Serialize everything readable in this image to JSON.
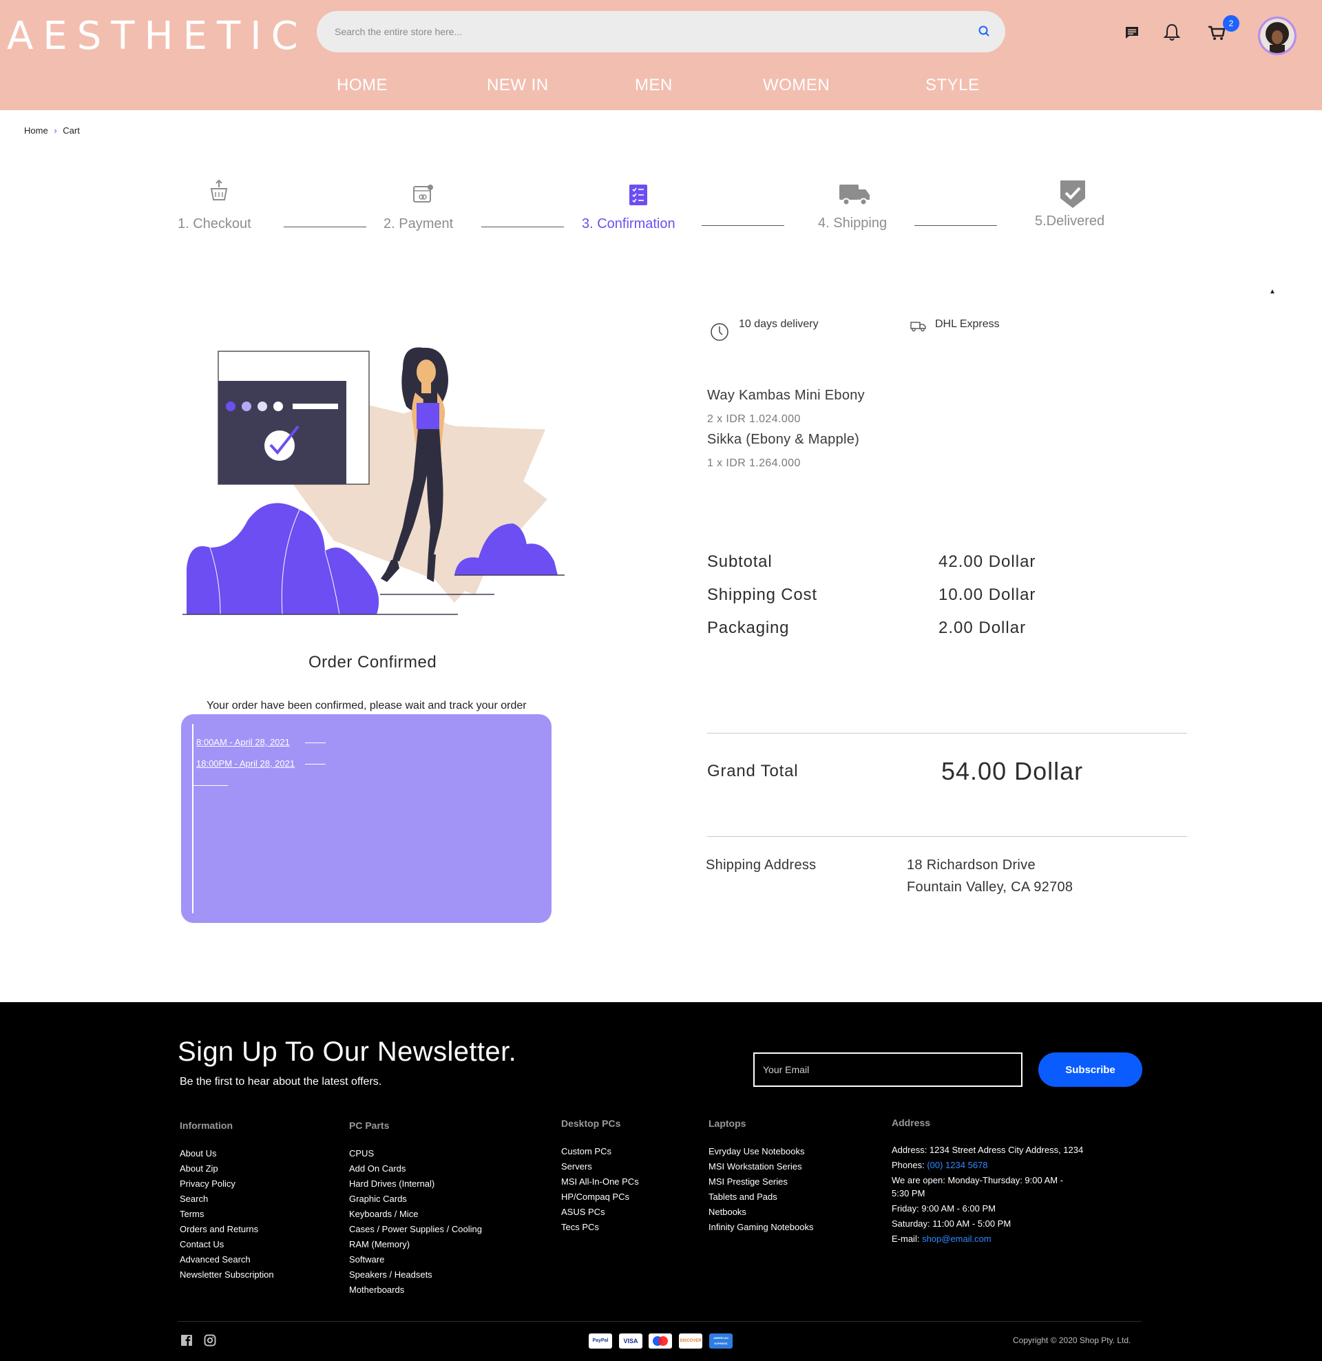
{
  "header": {
    "logo": "AESTHETIC",
    "search_placeholder": "Search the entire store here...",
    "cart_count": "2",
    "nav": [
      "HOME",
      "NEW IN",
      "MEN",
      "WOMEN",
      "STYLE"
    ]
  },
  "breadcrumb": {
    "home": "Home",
    "separator": "›",
    "current": "Cart"
  },
  "steps": [
    {
      "label": "1. Checkout",
      "icon": "basket-icon",
      "active": false
    },
    {
      "label": "2. Payment",
      "icon": "payment-icon",
      "active": false
    },
    {
      "label": "3. Confirmation",
      "icon": "checklist-icon",
      "active": true
    },
    {
      "label": "4. Shipping",
      "icon": "truck-icon",
      "active": false
    },
    {
      "label": "5.Delivered",
      "icon": "shield-check-icon",
      "active": false
    }
  ],
  "delivery": {
    "time": "10 days delivery",
    "carrier": "DHL Express"
  },
  "items": [
    {
      "name": "Way Kambas Mini Ebony",
      "qty": "2 x IDR 1.024.000"
    },
    {
      "name": "Sikka (Ebony & Mapple)",
      "qty": "1 x IDR 1.264.000"
    }
  ],
  "summary": {
    "subtotal_label": "Subtotal",
    "subtotal_value": "42.00 Dollar",
    "shipping_label": "Shipping Cost",
    "shipping_value": "10.00 Dollar",
    "packaging_label": "Packaging",
    "packaging_value": "2.00 Dollar",
    "grand_label": "Grand Total",
    "grand_value": "54.00 Dollar"
  },
  "shipping_address": {
    "label": "Shipping Address",
    "line1": "18 Richardson Drive",
    "line2": "Fountain Valley, CA 92708"
  },
  "confirmation": {
    "title": "Order Confirmed",
    "subtitle": "Your order have been confirmed, please wait and track your order",
    "tracking": [
      "8:00AM - April 28, 2021",
      "18:00PM - April 28, 2021"
    ]
  },
  "footer": {
    "newsletter_title": "Sign Up To Our Newsletter.",
    "newsletter_sub": "Be the first to hear about the latest offers.",
    "email_placeholder": "Your Email",
    "subscribe": "Subscribe",
    "columns": [
      {
        "title": "Information",
        "items": [
          "About Us",
          "About Zip",
          "Privacy Policy",
          "Search",
          "Terms",
          "Orders and Returns",
          "Contact Us",
          "Advanced Search",
          "Newsletter Subscription"
        ]
      },
      {
        "title": "PC Parts",
        "items": [
          "CPUS",
          "Add On Cards",
          "Hard Drives (Internal)",
          "Graphic Cards",
          "Keyboards / Mice",
          "Cases / Power Supplies / Cooling",
          "RAM (Memory)",
          "Software",
          "Speakers / Headsets",
          "Motherboards"
        ]
      },
      {
        "title": "Desktop PCs",
        "items": [
          "Custom PCs",
          "Servers",
          "MSI All-In-One PCs",
          "HP/Compaq PCs",
          "ASUS PCs",
          "Tecs PCs"
        ]
      },
      {
        "title": "Laptops",
        "items": [
          "Evryday Use Notebooks",
          "MSI Workstation Series",
          "MSI Prestige Series",
          "Tablets and Pads",
          "Netbooks",
          "Infinity Gaming Notebooks"
        ]
      }
    ],
    "address": {
      "title": "Address",
      "line1": "Address: 1234 Street Adress City Address, 1234",
      "phones_label": "Phones: ",
      "phone": "(00) 1234 5678",
      "open1": "We are open: Monday-Thursday: 9:00 AM -",
      "open2": "5:30 PM",
      "friday": "Friday: 9:00 AM - 6:00 PM",
      "saturday": "Saturday: 11:00 AM - 5:00 PM",
      "email_label": "E-mail: ",
      "email": "shop@email.com"
    },
    "payments": [
      "PayPal",
      "VISA",
      "Maestro",
      "DISCOVER",
      "AMERICAN EXPRESS"
    ],
    "copyright": "Copyright © 2020 Shop Pty. Ltd."
  },
  "colors": {
    "header_bg": "#f2beb0",
    "accent": "#6c4ef2",
    "track_bg": "#a293f7",
    "subscribe": "#0a5cff"
  }
}
